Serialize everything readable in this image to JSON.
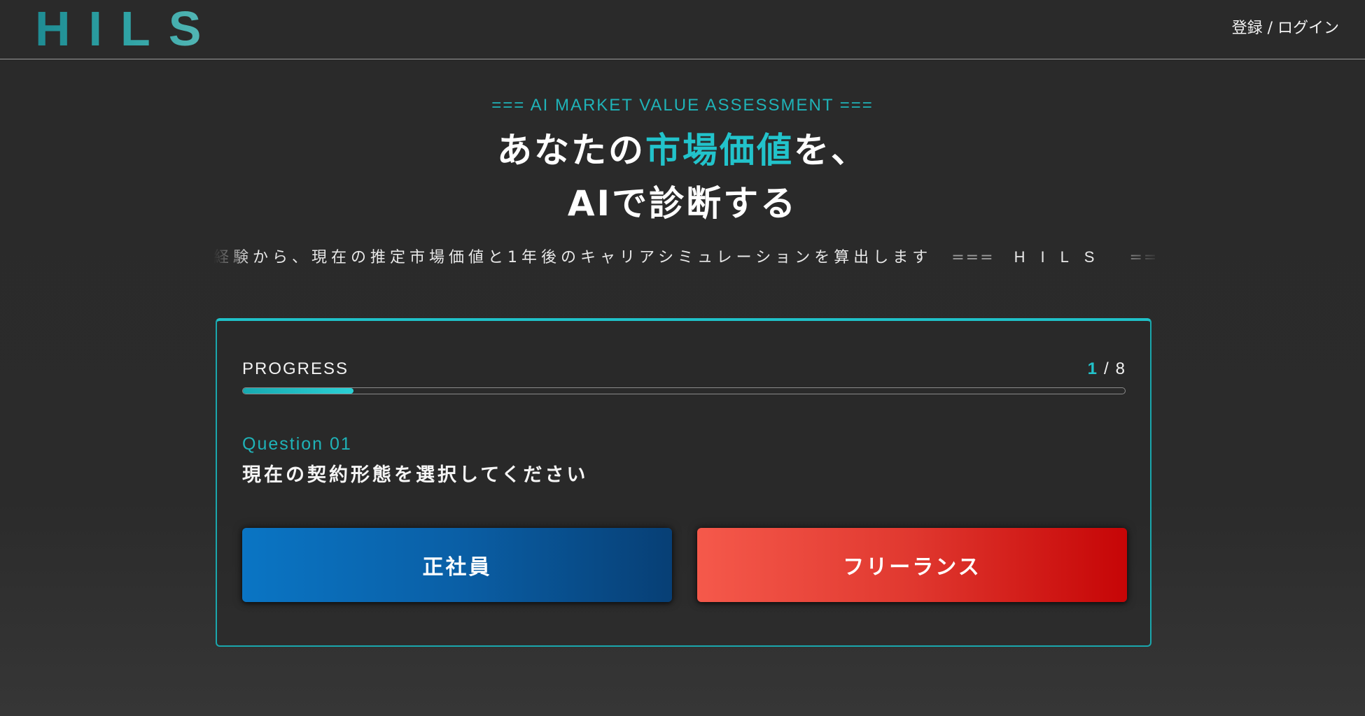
{
  "header": {
    "logo": "HILS",
    "login_label": "登録 / ログイン"
  },
  "hero": {
    "eyebrow": "=== AI MARKET VALUE ASSESSMENT ===",
    "headline_line1_pre": "あなたの",
    "headline_line1_accent": "市場価値",
    "headline_line1_post": "を、",
    "headline_line2": "AIで診断する",
    "ticker_text": "経験から、現在の推定市場価値と1年後のキャリアシミュレーションを算出します",
    "ticker_separator": "===",
    "ticker_brand": "HILS"
  },
  "quiz": {
    "progress_label": "PROGRESS",
    "progress_current": "1",
    "progress_separator": "/",
    "progress_total": "8",
    "progress_fraction": 0.125,
    "question_label": "Question 01",
    "question_text": "現在の契約形態を選択してください",
    "options": [
      {
        "label": "正社員"
      },
      {
        "label": "フリーランス"
      }
    ]
  },
  "colors": {
    "accent": "#22c3cb",
    "fulltime_button": "#0a5fa6",
    "freelance_button": "#e0382f",
    "background": "#2a2a2a"
  }
}
